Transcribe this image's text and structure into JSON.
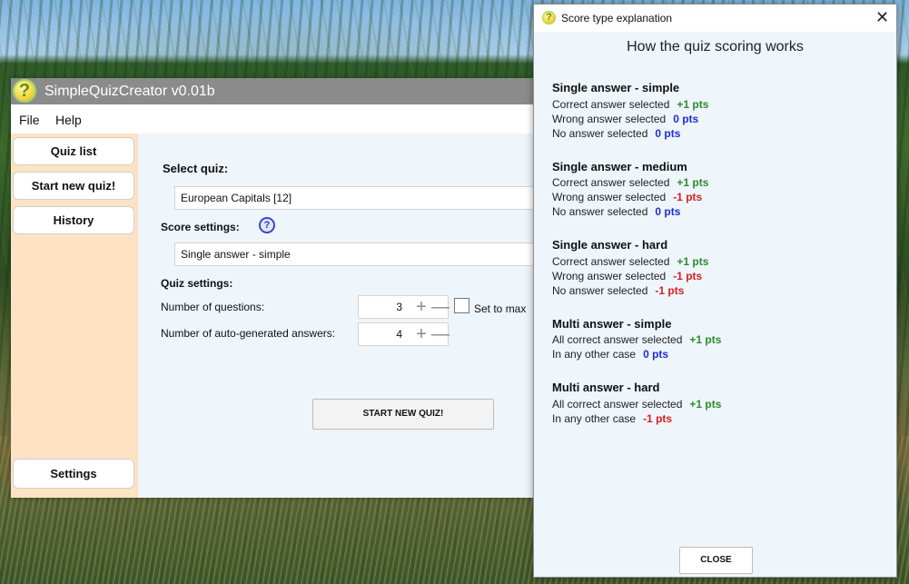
{
  "main_window": {
    "title": "SimpleQuizCreator v0.01b",
    "logo_glyph": "?",
    "menu": [
      "File",
      "Help"
    ],
    "sidebar": {
      "items": [
        "Quiz list",
        "Start new quiz!",
        "History"
      ],
      "settings_label": "Settings"
    },
    "select_quiz_label": "Select quiz:",
    "selected_quiz": "European Capitals [12]",
    "score_settings_label": "Score settings:",
    "help_glyph": "?",
    "selected_score": "Single answer - simple",
    "quiz_settings_label": "Quiz settings:",
    "num_questions_label": "Number of questions:",
    "num_questions_value": "3",
    "set_to_max_label": "Set to max",
    "num_answers_label": "Number of auto-generated answers:",
    "num_answers_value": "4",
    "plus_glyph": "+",
    "minus_glyph": "—",
    "start_button": "START NEW QUIZ!"
  },
  "dialog": {
    "logo_glyph": "?",
    "title": "Score type explanation",
    "close_x": "✕",
    "heading": "How the quiz scoring works",
    "sections": [
      {
        "title": "Single answer - simple",
        "lines": [
          {
            "text": "Correct answer selected",
            "pts": "+1 pts",
            "color": "#2e8b2e"
          },
          {
            "text": "Wrong answer selected",
            "pts": "0 pts",
            "color": "#1f2fcf"
          },
          {
            "text": "No answer selected",
            "pts": "0 pts",
            "color": "#1f2fcf"
          }
        ]
      },
      {
        "title": "Single answer - medium",
        "lines": [
          {
            "text": "Correct answer selected",
            "pts": "+1 pts",
            "color": "#2e8b2e"
          },
          {
            "text": "Wrong answer selected",
            "pts": "-1 pts",
            "color": "#d42020"
          },
          {
            "text": "No answer selected",
            "pts": "0 pts",
            "color": "#1f2fcf"
          }
        ]
      },
      {
        "title": "Single answer - hard",
        "lines": [
          {
            "text": "Correct answer selected",
            "pts": "+1 pts",
            "color": "#2e8b2e"
          },
          {
            "text": "Wrong answer selected",
            "pts": "-1 pts",
            "color": "#d42020"
          },
          {
            "text": "No answer selected",
            "pts": "-1 pts",
            "color": "#d42020"
          }
        ]
      },
      {
        "title": "Multi answer - simple",
        "lines": [
          {
            "text": "All correct answer selected",
            "pts": "+1 pts",
            "color": "#2e8b2e"
          },
          {
            "text": "In any other case",
            "pts": "0 pts",
            "color": "#1f2fcf"
          }
        ]
      },
      {
        "title": "Multi answer - hard",
        "lines": [
          {
            "text": "All correct answer selected",
            "pts": "+1 pts",
            "color": "#2e8b2e"
          },
          {
            "text": "In any other case",
            "pts": "-1 pts",
            "color": "#d42020"
          }
        ]
      }
    ],
    "close_button": "CLOSE"
  }
}
